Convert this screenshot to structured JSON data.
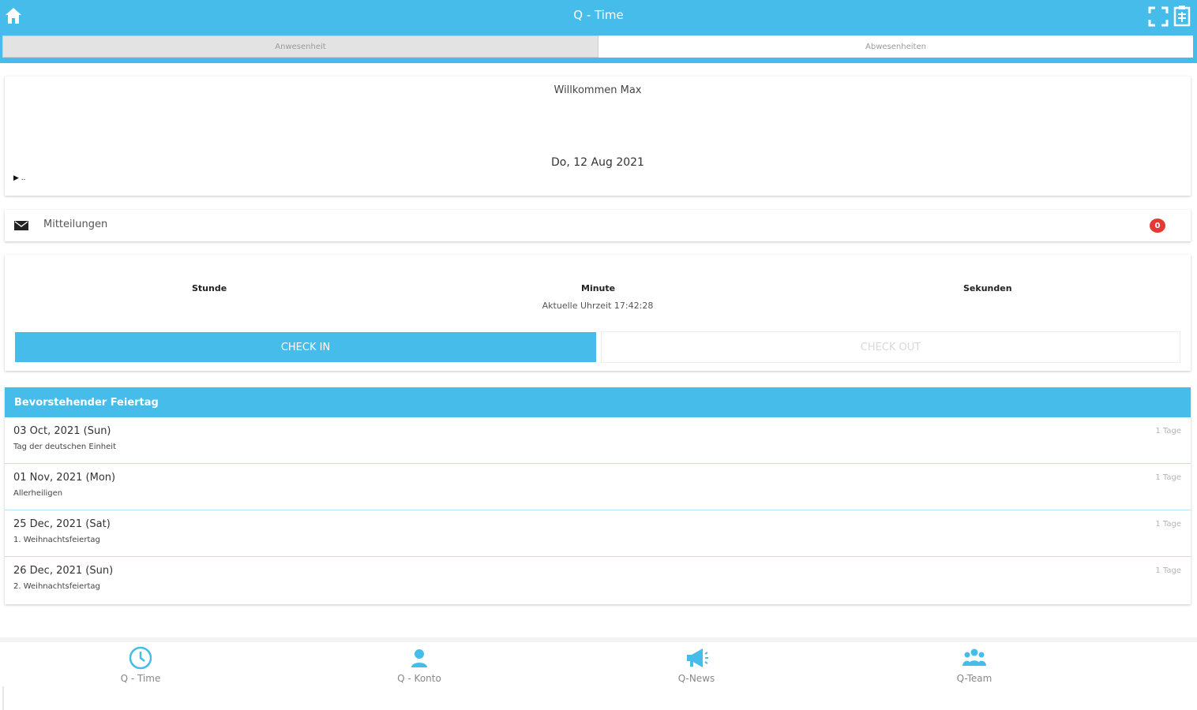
{
  "header": {
    "title": "Q - Time",
    "color": "#45bcea",
    "icons": [
      "home-icon",
      "fullscreen-icon",
      "clipboard-icon"
    ]
  },
  "tabs": [
    {
      "label": "Anwesenheit",
      "active": true
    },
    {
      "label": "Abwesenheiten",
      "active": false
    }
  ],
  "welcome": {
    "greeting": "Willkommen Max",
    "date": "Do, 12 Aug 2021",
    "indicator": "▶ .."
  },
  "notifications": {
    "label": "Mitteilungen",
    "count": "0"
  },
  "timer": {
    "hour_label": "Stunde",
    "minute_label": "Minute",
    "second_label": "Sekunden",
    "current_time": "Aktuelle Uhrzeit 17:42:28",
    "checkin_label": "CHECK IN",
    "checkout_label": "CHECK OUT"
  },
  "holidays": {
    "title": "Bevorstehender Feiertag",
    "items": [
      {
        "date": "03 Oct, 2021 (Sun)",
        "name": "Tag der deutschen Einheit",
        "days": "1 Tage"
      },
      {
        "date": "01 Nov, 2021 (Mon)",
        "name": "Allerheiligen",
        "days": "1 Tage"
      },
      {
        "date": "25 Dec, 2021 (Sat)",
        "name": "1. Weihnachtsfeiertag",
        "days": "1 Tage"
      },
      {
        "date": "26 Dec, 2021 (Sun)",
        "name": "2. Weihnachtsfeiertag",
        "days": "1 Tage"
      }
    ]
  },
  "bottom_nav": [
    {
      "label": "Q - Time",
      "icon": "clock-icon"
    },
    {
      "label": "Q - Konto",
      "icon": "person-icon"
    },
    {
      "label": "Q-News",
      "icon": "megaphone-icon"
    },
    {
      "label": "Q-Team",
      "icon": "team-icon"
    }
  ]
}
